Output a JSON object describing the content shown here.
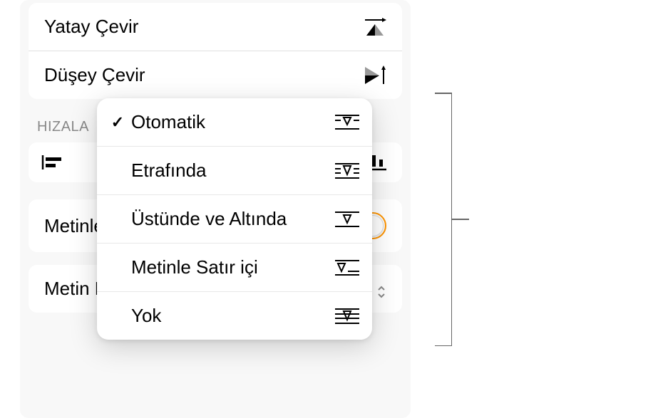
{
  "flip": {
    "horizontal": "Yatay Çevir",
    "vertical": "Düşey Çevir"
  },
  "alignSection": "HIZALA",
  "moveWithText": {
    "label": "Metinle Taşı"
  },
  "textWrap": {
    "label": "Metin Kaydırma",
    "value": "Otomatik"
  },
  "popup": {
    "items": [
      {
        "label": "Otomatik",
        "checked": true
      },
      {
        "label": "Etrafında",
        "checked": false
      },
      {
        "label": "Üstünde ve Altında",
        "checked": false
      },
      {
        "label": "Metinle Satır içi",
        "checked": false
      },
      {
        "label": "Yok",
        "checked": false
      }
    ]
  }
}
